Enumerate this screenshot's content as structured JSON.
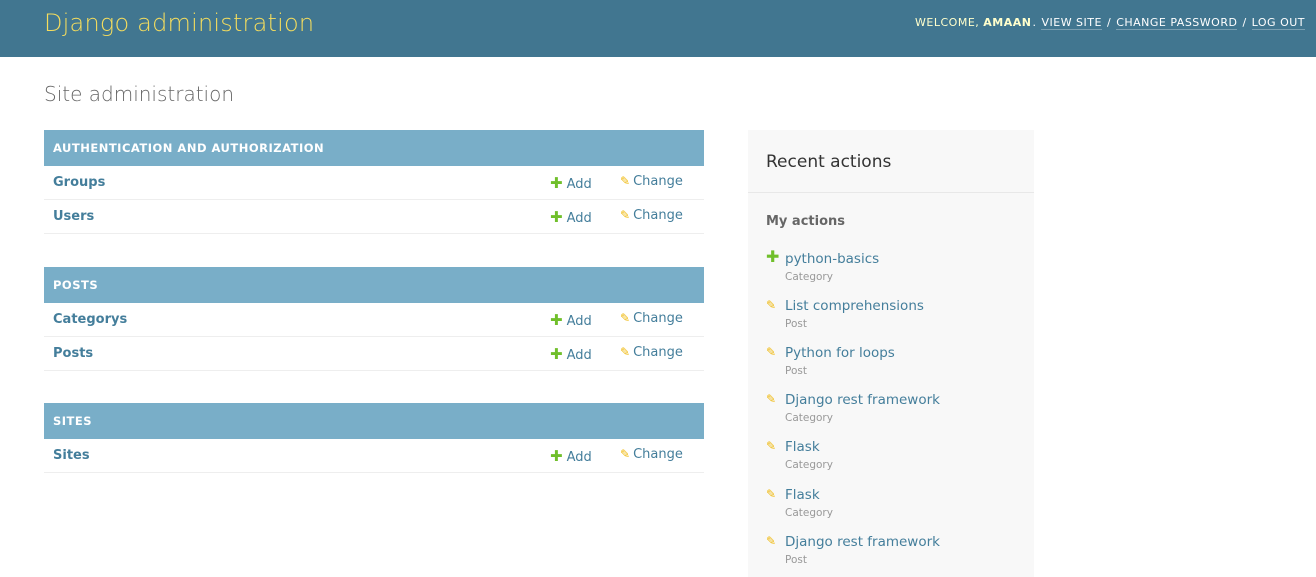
{
  "header": {
    "branding": "Django administration",
    "welcome": "WELCOME,",
    "username": "AMAAN",
    "view_site": "VIEW SITE",
    "change_password": "CHANGE PASSWORD",
    "log_out": "LOG OUT",
    "separator": "/"
  },
  "page_title": "Site administration",
  "modules": [
    {
      "caption": "AUTHENTICATION AND AUTHORIZATION",
      "rows": [
        {
          "name": "Groups",
          "add": "Add",
          "change": "Change"
        },
        {
          "name": "Users",
          "add": "Add",
          "change": "Change"
        }
      ]
    },
    {
      "caption": "POSTS",
      "rows": [
        {
          "name": "Categorys",
          "add": "Add",
          "change": "Change"
        },
        {
          "name": "Posts",
          "add": "Add",
          "change": "Change"
        }
      ]
    },
    {
      "caption": "SITES",
      "rows": [
        {
          "name": "Sites",
          "add": "Add",
          "change": "Change"
        }
      ]
    }
  ],
  "icons": {
    "add": "plus-icon",
    "change": "pencil-icon",
    "add_glyph": "✚",
    "change_glyph": "✎"
  },
  "colors": {
    "header_bg": "#417690",
    "branding": "#f5dd5d",
    "caption_bg": "#79aec8",
    "link": "#447e9b",
    "add_icon": "#70bf2b",
    "change_icon": "#efb80b"
  },
  "recent": {
    "title": "Recent actions",
    "my_actions": "My actions",
    "items": [
      {
        "action": "add",
        "title": "python-basics",
        "type": "Category"
      },
      {
        "action": "change",
        "title": "List comprehensions",
        "type": "Post"
      },
      {
        "action": "change",
        "title": "Python for loops",
        "type": "Post"
      },
      {
        "action": "change",
        "title": "Django rest framework",
        "type": "Category"
      },
      {
        "action": "change",
        "title": "Flask",
        "type": "Category"
      },
      {
        "action": "change",
        "title": "Flask",
        "type": "Category"
      },
      {
        "action": "change",
        "title": "Django rest framework",
        "type": "Post"
      }
    ]
  }
}
